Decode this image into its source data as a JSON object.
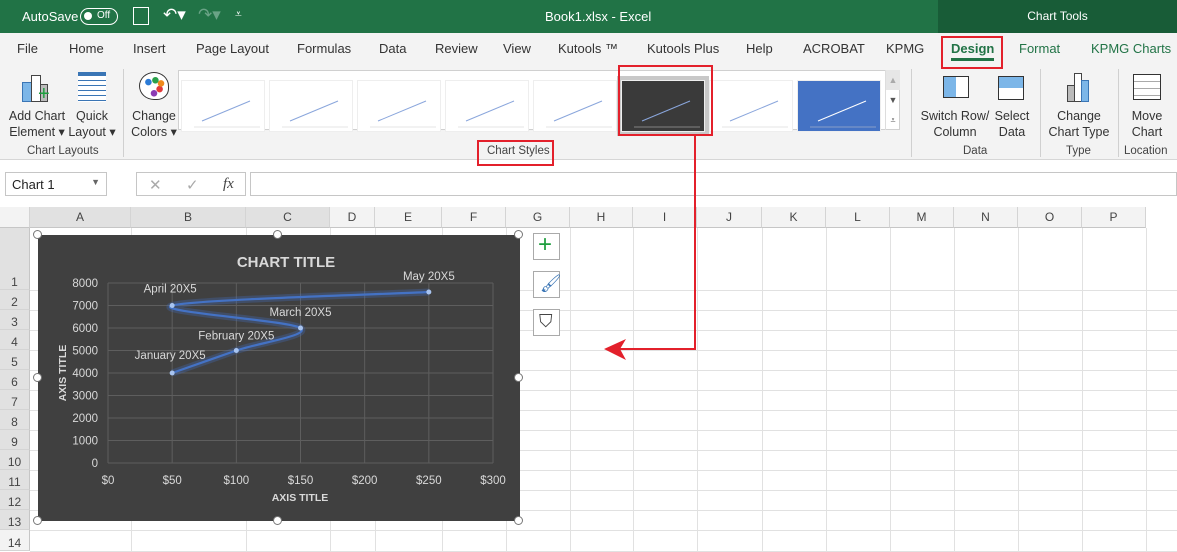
{
  "titlebar": {
    "autosave": "AutoSave",
    "autosave_state": "Off",
    "doc_title": "Book1.xlsx  -  Excel",
    "context": "Chart Tools"
  },
  "tabs": [
    "File",
    "Home",
    "Insert",
    "Page Layout",
    "Formulas",
    "Data",
    "Review",
    "View",
    "Kutools ™",
    "Kutools Plus",
    "Help",
    "ACROBAT",
    "KPMG",
    "Design",
    "Format",
    "KPMG Charts"
  ],
  "active_tab": "Design",
  "ribbon": {
    "add_chart_element": [
      "Add Chart",
      "Element ▾"
    ],
    "quick_layout": [
      "Quick",
      "Layout ▾"
    ],
    "chart_layouts": "Chart Layouts",
    "change_colors": [
      "Change",
      "Colors ▾"
    ],
    "chart_styles": "Chart Styles",
    "switch_row": [
      "Switch Row/",
      "Column"
    ],
    "select_data": [
      "Select",
      "Data"
    ],
    "data_group": "Data",
    "change_type": [
      "Change",
      "Chart Type"
    ],
    "type_group": "Type",
    "move_chart": [
      "Move",
      "Chart"
    ],
    "location_group": "Location",
    "selected_style_index": 5
  },
  "formula": {
    "name_box": "Chart 1",
    "fx": "fx",
    "cancel": "✕",
    "enter": "✓",
    "value": ""
  },
  "columns": [
    "A",
    "B",
    "C",
    "D",
    "E",
    "F",
    "G",
    "H",
    "I",
    "J",
    "K",
    "L",
    "M",
    "N",
    "O",
    "P"
  ],
  "rows": [
    "1",
    "2",
    "3",
    "4",
    "5",
    "6",
    "7",
    "8",
    "9",
    "10",
    "11",
    "12",
    "13",
    "14"
  ],
  "accent": "#217346",
  "annotation_color": "#e3202b",
  "chart_data": {
    "type": "scatter",
    "title": "CHART TITLE",
    "xlabel": "AXIS TITLE",
    "ylabel": "AXIS TITLE",
    "xlim": [
      0,
      300
    ],
    "ylim": [
      0,
      8000
    ],
    "xticks": [
      "$0",
      "$50",
      "$100",
      "$150",
      "$200",
      "$250",
      "$300"
    ],
    "yticks": [
      "0",
      "1000",
      "2000",
      "3000",
      "4000",
      "5000",
      "6000",
      "7000",
      "8000"
    ],
    "grid": true,
    "smooth": true,
    "background": "#404040",
    "line_color": "#4472c4",
    "points": [
      {
        "label": "January 20X5",
        "x": 50,
        "y": 4000
      },
      {
        "label": "February 20X5",
        "x": 100,
        "y": 5000
      },
      {
        "label": "March 20X5",
        "x": 150,
        "y": 6000
      },
      {
        "label": "April 20X5",
        "x": 50,
        "y": 7000
      },
      {
        "label": "May 20X5",
        "x": 250,
        "y": 7600
      }
    ]
  }
}
